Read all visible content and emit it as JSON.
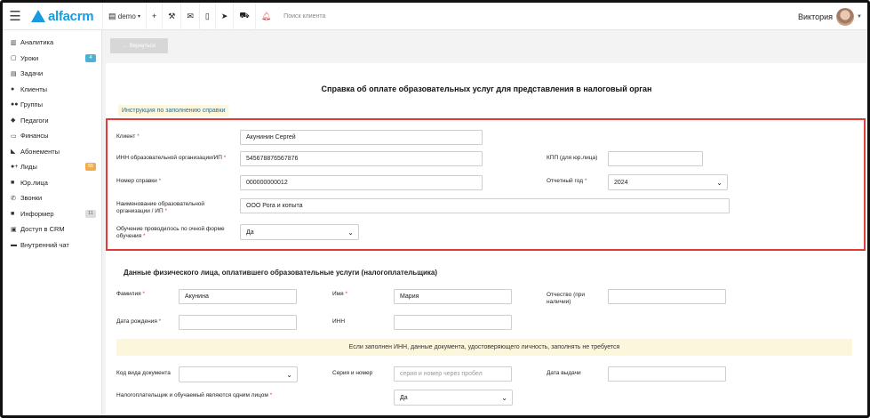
{
  "topbar": {
    "logo": "alfacrm",
    "branch": "demo",
    "search_placeholder": "Поиск клиента",
    "user_name": "Виктория"
  },
  "sidebar": {
    "items": [
      {
        "label": "Аналитика",
        "icon": "chart-icon"
      },
      {
        "label": "Уроки",
        "icon": "calendar-icon",
        "badge": "4"
      },
      {
        "label": "Задачи",
        "icon": "tasks-icon"
      },
      {
        "label": "Клиенты",
        "icon": "user-icon"
      },
      {
        "label": "Группы",
        "icon": "users-icon"
      },
      {
        "label": "Педагоги",
        "icon": "graduation-icon"
      },
      {
        "label": "Финансы",
        "icon": "money-icon"
      },
      {
        "label": "Абонементы",
        "icon": "tag-icon"
      },
      {
        "label": "Лиды",
        "icon": "user-plus-icon",
        "badge": "55"
      },
      {
        "label": "Юр.лица",
        "icon": "briefcase-icon"
      },
      {
        "label": "Звонки",
        "icon": "phone-icon"
      },
      {
        "label": "Информер",
        "icon": "informer-icon",
        "badge": "11"
      },
      {
        "label": "Доступ в CRM",
        "icon": "lock-icon"
      },
      {
        "label": "Внутренний чат",
        "icon": "chat-icon"
      }
    ]
  },
  "actions": {
    "back_label": "← Вернуться"
  },
  "page": {
    "title": "Справка об оплате образовательных услуг для представления в налоговый орган",
    "instruction_link": "Инструкция по заполнению справки"
  },
  "form": {
    "client_label": "Клиент",
    "client_value": "Акунинин Сергей",
    "inn_org_label": "ИНН образовательной организации/ИП",
    "inn_org_value": "545678876567876",
    "kpp_label": "КПП (для юр.лица)",
    "kpp_value": "",
    "cert_no_label": "Номер справки",
    "cert_no_value": "000000000012",
    "year_label": "Отчетный год",
    "year_value": "2024",
    "org_name_label_1": "Наименование образовательной",
    "org_name_label_2": "организации / ИП",
    "org_name_value": "ООО Рога и копыта",
    "fulltime_label_1": "Обучение проводилось по очной форме",
    "fulltime_label_2": "обучения",
    "fulltime_value": "Да"
  },
  "payer": {
    "section_title": "Данные физического лица, оплатившего образовательные услуги (налогоплательщика)",
    "surname_label": "Фамилия",
    "surname_value": "Акунина",
    "name_label": "Имя",
    "name_value": "Мария",
    "patronymic_label_1": "Отчество (при",
    "patronymic_label_2": "наличии)",
    "patronymic_value": "",
    "birth_label": "Дата рождения",
    "birth_value": "",
    "inn_label": "ИНН",
    "inn_value": "",
    "note": "Если заполнен ИНН, данные документа, удостоверяющего личность, заполнять не требуется",
    "doc_code_label": "Код вида документа",
    "doc_code_value": "",
    "series_label": "Серия и номер",
    "series_placeholder": "серия и номер через пробел",
    "issue_date_label": "Дата выдачи",
    "issue_date_value": "",
    "same_person_label": "Налогоплательщик и обучаемый являются одним лицом",
    "same_person_value": "Да"
  }
}
